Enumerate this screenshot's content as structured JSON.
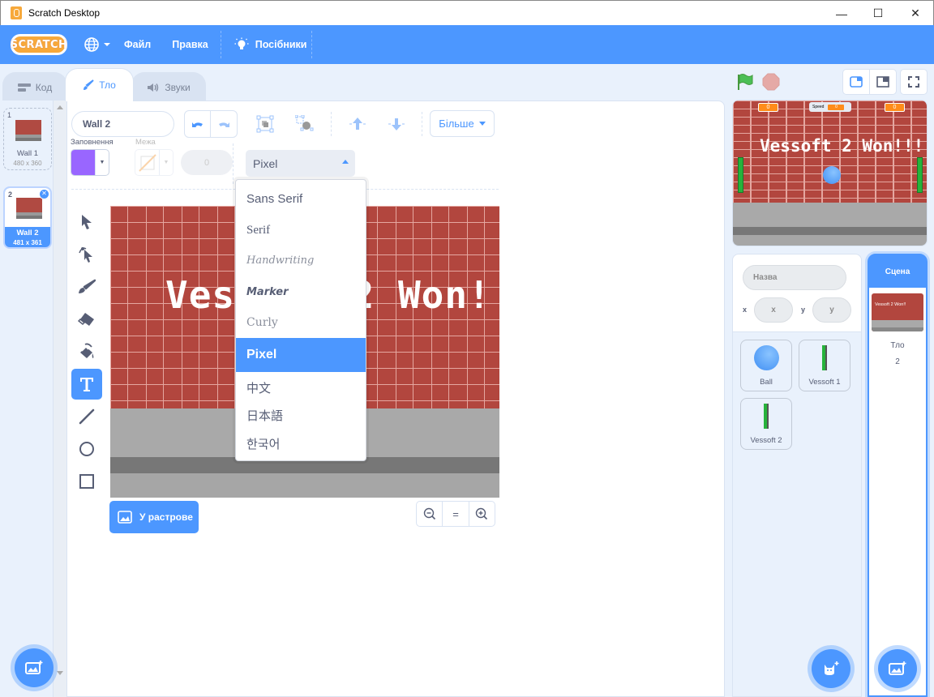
{
  "window": {
    "title": "Scratch Desktop",
    "controls": {
      "minimize": "—",
      "maximize": "☐",
      "close": "✕"
    }
  },
  "menubar": {
    "logo": "SCRATCH",
    "language_icon": "globe-icon",
    "file": "Файл",
    "edit": "Правка",
    "tutorials": "Посібники"
  },
  "tabs": [
    {
      "label": "Код",
      "icon": "code-icon",
      "active": false
    },
    {
      "label": "Тло",
      "icon": "brush-icon",
      "active": true
    },
    {
      "label": "Звуки",
      "icon": "sound-icon",
      "active": false
    }
  ],
  "costumes": [
    {
      "index": "1",
      "name": "Wall 1",
      "size": "480 x 360",
      "selected": false
    },
    {
      "index": "2",
      "name": "Wall 2",
      "size": "481 x 361",
      "selected": true
    }
  ],
  "paint_editor": {
    "costume_name": "Wall 2",
    "more_label": "Більше",
    "fill_label": "Заповнення",
    "outline_label": "Межа",
    "outline_width": "0",
    "fill_color": "#9966ff",
    "font_selected": "Pixel",
    "font_options": [
      "Sans Serif",
      "Serif",
      "Handwriting",
      "Marker",
      "Curly",
      "Pixel",
      "中文",
      "日本語",
      "한국어"
    ],
    "font_highlighted_index": 5,
    "canvas_text": "Vessoft 2 Won!!!",
    "convert_button": "У растрове",
    "zoom_reset": "="
  },
  "tools": [
    "select",
    "reshape",
    "brush",
    "eraser",
    "fill",
    "text",
    "line",
    "circle",
    "rectangle"
  ],
  "active_tool": "text",
  "stage": {
    "text": "Vessoft 2 Won!!!",
    "score_left": "0",
    "score_right": "0",
    "speed_label": "Speed",
    "speed_value": "0"
  },
  "sprite_info": {
    "name_placeholder": "Назва",
    "x_label": "x",
    "x_placeholder": "x",
    "y_label": "y",
    "y_placeholder": "y"
  },
  "sprites": [
    {
      "name": "Ball"
    },
    {
      "name": "Vessoft 1"
    },
    {
      "name": "Vessoft 2"
    }
  ],
  "stage_pane": {
    "header": "Сцена",
    "thumb_text": "Vessoft 2 Won!!",
    "backdrops_label": "Тло",
    "backdrops_count": "2"
  },
  "colors": {
    "accent": "#4c97ff",
    "fill": "#9966ff",
    "monitor": "#ff8c1a"
  }
}
